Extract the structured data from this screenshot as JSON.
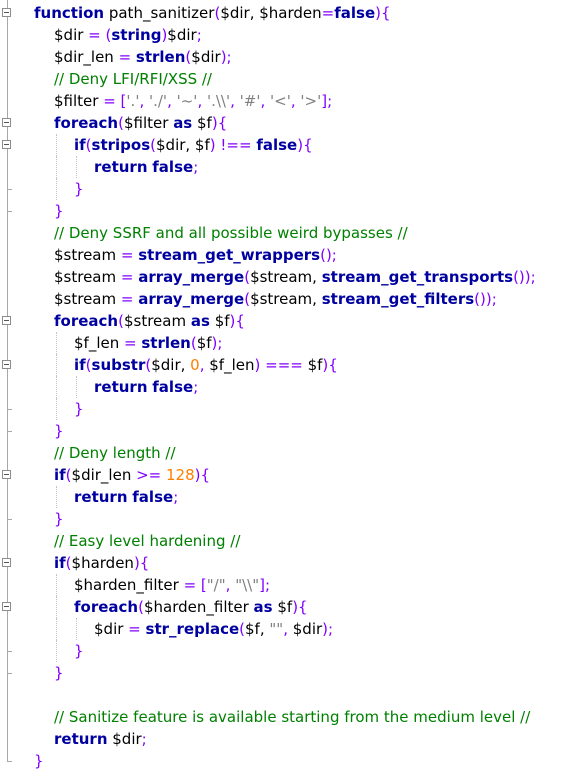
{
  "code": {
    "language": "PHP",
    "lines": [
      {
        "indent": 0,
        "tokens": [
          {
            "t": "function",
            "c": "kw"
          },
          {
            "t": " path_sanitizer",
            "c": "var"
          },
          {
            "t": "(",
            "c": "op"
          },
          {
            "t": "$dir, $harden",
            "c": "var"
          },
          {
            "t": "=",
            "c": "op"
          },
          {
            "t": "false",
            "c": "kw"
          },
          {
            "t": "){",
            "c": "op"
          }
        ]
      },
      {
        "indent": 1,
        "tokens": [
          {
            "t": "$dir ",
            "c": "var"
          },
          {
            "t": "= (",
            "c": "op"
          },
          {
            "t": "string",
            "c": "kw"
          },
          {
            "t": ")",
            "c": "op"
          },
          {
            "t": "$dir",
            "c": "var"
          },
          {
            "t": ";",
            "c": "op"
          }
        ]
      },
      {
        "indent": 1,
        "tokens": [
          {
            "t": "$dir_len ",
            "c": "var"
          },
          {
            "t": "= ",
            "c": "op"
          },
          {
            "t": "strlen",
            "c": "fn"
          },
          {
            "t": "(",
            "c": "op"
          },
          {
            "t": "$dir",
            "c": "var"
          },
          {
            "t": ");",
            "c": "op"
          }
        ]
      },
      {
        "indent": 1,
        "tokens": [
          {
            "t": "// Deny LFI/RFI/XSS //",
            "c": "cm"
          }
        ]
      },
      {
        "indent": 1,
        "tokens": [
          {
            "t": "$filter ",
            "c": "var"
          },
          {
            "t": "= [",
            "c": "op"
          },
          {
            "t": "'.'",
            "c": "str"
          },
          {
            "t": ", ",
            "c": "op"
          },
          {
            "t": "'./'",
            "c": "str"
          },
          {
            "t": ", ",
            "c": "op"
          },
          {
            "t": "'~'",
            "c": "str"
          },
          {
            "t": ", ",
            "c": "op"
          },
          {
            "t": "'.\\\\'",
            "c": "str"
          },
          {
            "t": ", ",
            "c": "op"
          },
          {
            "t": "'#'",
            "c": "str"
          },
          {
            "t": ", ",
            "c": "op"
          },
          {
            "t": "'<'",
            "c": "str"
          },
          {
            "t": ", ",
            "c": "op"
          },
          {
            "t": "'>'",
            "c": "str"
          },
          {
            "t": "];",
            "c": "op"
          }
        ]
      },
      {
        "indent": 1,
        "tokens": [
          {
            "t": "foreach",
            "c": "kw"
          },
          {
            "t": "(",
            "c": "op"
          },
          {
            "t": "$filter ",
            "c": "var"
          },
          {
            "t": "as",
            "c": "kw"
          },
          {
            "t": " $f",
            "c": "var"
          },
          {
            "t": "){",
            "c": "op"
          }
        ]
      },
      {
        "indent": 2,
        "tokens": [
          {
            "t": "if",
            "c": "kw"
          },
          {
            "t": "(",
            "c": "op"
          },
          {
            "t": "stripos",
            "c": "fn"
          },
          {
            "t": "(",
            "c": "op"
          },
          {
            "t": "$dir, $f",
            "c": "var"
          },
          {
            "t": ") !== ",
            "c": "op"
          },
          {
            "t": "false",
            "c": "kw"
          },
          {
            "t": "){",
            "c": "op"
          }
        ]
      },
      {
        "indent": 3,
        "tokens": [
          {
            "t": "return",
            "c": "kw"
          },
          {
            "t": " ",
            "c": "var"
          },
          {
            "t": "false",
            "c": "kw"
          },
          {
            "t": ";",
            "c": "op"
          }
        ]
      },
      {
        "indent": 2,
        "tokens": [
          {
            "t": "}",
            "c": "op"
          }
        ]
      },
      {
        "indent": 1,
        "tokens": [
          {
            "t": "}",
            "c": "op"
          }
        ]
      },
      {
        "indent": 1,
        "tokens": [
          {
            "t": "// Deny SSRF and all possible weird bypasses //",
            "c": "cm"
          }
        ]
      },
      {
        "indent": 1,
        "tokens": [
          {
            "t": "$stream ",
            "c": "var"
          },
          {
            "t": "= ",
            "c": "op"
          },
          {
            "t": "stream_get_wrappers",
            "c": "fn"
          },
          {
            "t": "();",
            "c": "op"
          }
        ]
      },
      {
        "indent": 1,
        "tokens": [
          {
            "t": "$stream ",
            "c": "var"
          },
          {
            "t": "= ",
            "c": "op"
          },
          {
            "t": "array_merge",
            "c": "fn"
          },
          {
            "t": "(",
            "c": "op"
          },
          {
            "t": "$stream, ",
            "c": "var"
          },
          {
            "t": "stream_get_transports",
            "c": "fn"
          },
          {
            "t": "());",
            "c": "op"
          }
        ]
      },
      {
        "indent": 1,
        "tokens": [
          {
            "t": "$stream ",
            "c": "var"
          },
          {
            "t": "= ",
            "c": "op"
          },
          {
            "t": "array_merge",
            "c": "fn"
          },
          {
            "t": "(",
            "c": "op"
          },
          {
            "t": "$stream, ",
            "c": "var"
          },
          {
            "t": "stream_get_filters",
            "c": "fn"
          },
          {
            "t": "());",
            "c": "op"
          }
        ]
      },
      {
        "indent": 1,
        "tokens": [
          {
            "t": "foreach",
            "c": "kw"
          },
          {
            "t": "(",
            "c": "op"
          },
          {
            "t": "$stream ",
            "c": "var"
          },
          {
            "t": "as",
            "c": "kw"
          },
          {
            "t": " $f",
            "c": "var"
          },
          {
            "t": "){",
            "c": "op"
          }
        ]
      },
      {
        "indent": 2,
        "tokens": [
          {
            "t": "$f_len ",
            "c": "var"
          },
          {
            "t": "= ",
            "c": "op"
          },
          {
            "t": "strlen",
            "c": "fn"
          },
          {
            "t": "(",
            "c": "op"
          },
          {
            "t": "$f",
            "c": "var"
          },
          {
            "t": ");",
            "c": "op"
          }
        ]
      },
      {
        "indent": 2,
        "tokens": [
          {
            "t": "if",
            "c": "kw"
          },
          {
            "t": "(",
            "c": "op"
          },
          {
            "t": "substr",
            "c": "fn"
          },
          {
            "t": "(",
            "c": "op"
          },
          {
            "t": "$dir, ",
            "c": "var"
          },
          {
            "t": "0",
            "c": "num"
          },
          {
            "t": ", ",
            "c": "op"
          },
          {
            "t": "$f_len",
            "c": "var"
          },
          {
            "t": ") === ",
            "c": "op"
          },
          {
            "t": "$f",
            "c": "var"
          },
          {
            "t": "){",
            "c": "op"
          }
        ]
      },
      {
        "indent": 3,
        "tokens": [
          {
            "t": "return",
            "c": "kw"
          },
          {
            "t": " ",
            "c": "var"
          },
          {
            "t": "false",
            "c": "kw"
          },
          {
            "t": ";",
            "c": "op"
          }
        ]
      },
      {
        "indent": 2,
        "tokens": [
          {
            "t": "}",
            "c": "op"
          }
        ]
      },
      {
        "indent": 1,
        "tokens": [
          {
            "t": "}",
            "c": "op"
          }
        ]
      },
      {
        "indent": 1,
        "tokens": [
          {
            "t": "// Deny length //",
            "c": "cm"
          }
        ]
      },
      {
        "indent": 1,
        "tokens": [
          {
            "t": "if",
            "c": "kw"
          },
          {
            "t": "(",
            "c": "op"
          },
          {
            "t": "$dir_len ",
            "c": "var"
          },
          {
            "t": ">= ",
            "c": "op"
          },
          {
            "t": "128",
            "c": "num"
          },
          {
            "t": "){",
            "c": "op"
          }
        ]
      },
      {
        "indent": 2,
        "tokens": [
          {
            "t": "return",
            "c": "kw"
          },
          {
            "t": " ",
            "c": "var"
          },
          {
            "t": "false",
            "c": "kw"
          },
          {
            "t": ";",
            "c": "op"
          }
        ]
      },
      {
        "indent": 1,
        "tokens": [
          {
            "t": "}",
            "c": "op"
          }
        ]
      },
      {
        "indent": 1,
        "tokens": [
          {
            "t": "// Easy level hardening //",
            "c": "cm"
          }
        ]
      },
      {
        "indent": 1,
        "tokens": [
          {
            "t": "if",
            "c": "kw"
          },
          {
            "t": "(",
            "c": "op"
          },
          {
            "t": "$harden",
            "c": "var"
          },
          {
            "t": "){",
            "c": "op"
          }
        ]
      },
      {
        "indent": 2,
        "tokens": [
          {
            "t": "$harden_filter ",
            "c": "var"
          },
          {
            "t": "= [",
            "c": "op"
          },
          {
            "t": "\"/\"",
            "c": "str"
          },
          {
            "t": ", ",
            "c": "op"
          },
          {
            "t": "\"\\\\\"",
            "c": "str"
          },
          {
            "t": "];",
            "c": "op"
          }
        ]
      },
      {
        "indent": 2,
        "tokens": [
          {
            "t": "foreach",
            "c": "kw"
          },
          {
            "t": "(",
            "c": "op"
          },
          {
            "t": "$harden_filter ",
            "c": "var"
          },
          {
            "t": "as",
            "c": "kw"
          },
          {
            "t": " $f",
            "c": "var"
          },
          {
            "t": "){",
            "c": "op"
          }
        ]
      },
      {
        "indent": 3,
        "tokens": [
          {
            "t": "$dir ",
            "c": "var"
          },
          {
            "t": "= ",
            "c": "op"
          },
          {
            "t": "str_replace",
            "c": "fn"
          },
          {
            "t": "(",
            "c": "op"
          },
          {
            "t": "$f, ",
            "c": "var"
          },
          {
            "t": "\"\"",
            "c": "str"
          },
          {
            "t": ", ",
            "c": "op"
          },
          {
            "t": "$dir",
            "c": "var"
          },
          {
            "t": ");",
            "c": "op"
          }
        ]
      },
      {
        "indent": 2,
        "tokens": [
          {
            "t": "}",
            "c": "op"
          }
        ]
      },
      {
        "indent": 1,
        "tokens": [
          {
            "t": "}",
            "c": "op"
          }
        ]
      },
      {
        "indent": 0,
        "tokens": []
      },
      {
        "indent": 1,
        "tokens": [
          {
            "t": "// Sanitize feature is available starting from the medium level //",
            "c": "cm"
          }
        ]
      },
      {
        "indent": 1,
        "tokens": [
          {
            "t": "return",
            "c": "kw"
          },
          {
            "t": " $dir",
            "c": "var"
          },
          {
            "t": ";",
            "c": "op"
          }
        ]
      },
      {
        "indent": 0,
        "tokens": [
          {
            "t": "}",
            "c": "op"
          }
        ]
      }
    ]
  },
  "fold_markers": [
    0,
    5,
    6,
    14,
    16,
    21,
    25,
    27
  ],
  "colors": {
    "keyword": "#0000a0",
    "comment": "#008000",
    "operator": "#8000ff",
    "string": "#808080",
    "number": "#ff8000",
    "text": "#000000"
  }
}
